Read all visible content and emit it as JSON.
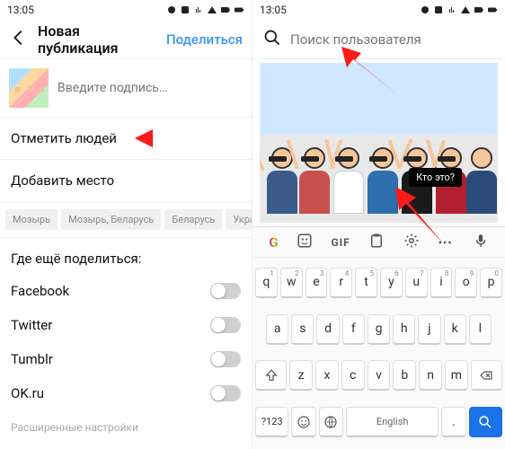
{
  "status": {
    "time": "13:05"
  },
  "left": {
    "title": "Новая публикация",
    "share": "Поделиться",
    "caption_placeholder": "Введите подпись…",
    "tag_people": "Отметить людей",
    "add_location": "Добавить место",
    "chips": [
      "Мозырь",
      "Мозырь, Беларусь",
      "Беларусь",
      "Украина"
    ],
    "share_also": "Где ещё поделиться:",
    "networks": [
      "Facebook",
      "Twitter",
      "Tumblr",
      "OK.ru"
    ],
    "advanced": "Расширенные настройки"
  },
  "right": {
    "search_placeholder": "Поиск пользователя",
    "tag_bubble": "Кто это?",
    "kb": {
      "row1": [
        [
          "q",
          "1"
        ],
        [
          "w",
          "2"
        ],
        [
          "e",
          "3"
        ],
        [
          "r",
          "4"
        ],
        [
          "t",
          "5"
        ],
        [
          "y",
          "6"
        ],
        [
          "u",
          "7"
        ],
        [
          "i",
          "8"
        ],
        [
          "o",
          "9"
        ],
        [
          "p",
          "0"
        ]
      ],
      "row2": [
        "a",
        "s",
        "d",
        "f",
        "g",
        "h",
        "j",
        "k",
        "l"
      ],
      "row3": [
        "z",
        "x",
        "c",
        "v",
        "b",
        "n",
        "m"
      ],
      "sym": "?123",
      "lang": "English",
      "gif": "GIF"
    }
  }
}
